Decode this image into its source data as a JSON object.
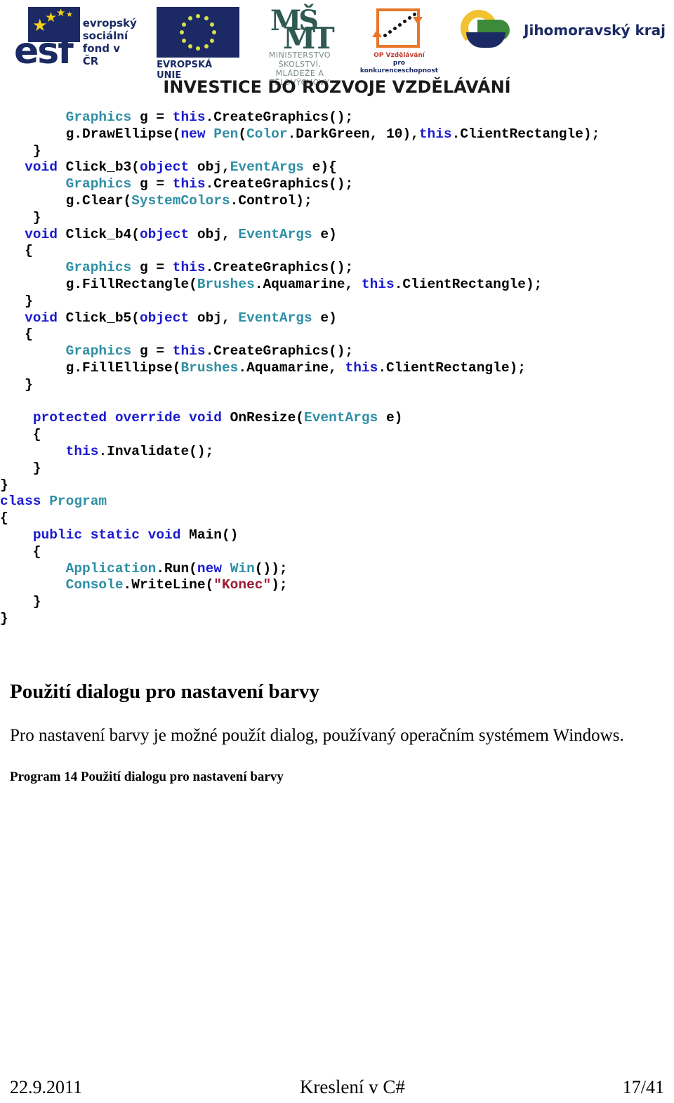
{
  "header": {
    "logos": [
      {
        "id": "esf-logo",
        "text_lines": [
          "evropský",
          "sociální",
          "fond v ČR"
        ],
        "wordmark": "esf"
      },
      {
        "id": "eu-flag-logo",
        "label": "EVROPSKÁ UNIE"
      },
      {
        "id": "msmt-logo",
        "mark_top": "MŠ",
        "mark_bottom": "MT",
        "label_line1": "MINISTERSTVO ŠKOLSTVÍ,",
        "label_line2": "MLÁDEŽE A TĚLOVÝCHOVY"
      },
      {
        "id": "op-vzdelavani-logo",
        "label_line1": "OP Vzdělávání",
        "label_line2": "pro konkurenceschopnost"
      },
      {
        "id": "jihomoravsky-kraj-logo",
        "label": "Jihomoravský kraj"
      }
    ],
    "banner_text": "INVESTICE DO ROZVOJE VZDĚLÁVÁNÍ"
  },
  "code": {
    "language": "csharp",
    "lines": [
      [
        {
          "t": "        ",
          "c": ""
        },
        {
          "t": "Graphics",
          "c": "typ"
        },
        {
          "t": " g = ",
          "c": ""
        },
        {
          "t": "this",
          "c": "kw"
        },
        {
          "t": ".CreateGraphics();",
          "c": ""
        }
      ],
      [
        {
          "t": "        g.DrawEllipse(",
          "c": ""
        },
        {
          "t": "new",
          "c": "kw"
        },
        {
          "t": " ",
          "c": ""
        },
        {
          "t": "Pen",
          "c": "typ"
        },
        {
          "t": "(",
          "c": ""
        },
        {
          "t": "Color",
          "c": "typ"
        },
        {
          "t": ".DarkGreen, 10),",
          "c": ""
        },
        {
          "t": "this",
          "c": "kw"
        },
        {
          "t": ".ClientRectangle);",
          "c": ""
        }
      ],
      [
        {
          "t": "    }",
          "c": ""
        }
      ],
      [
        {
          "t": "   ",
          "c": ""
        },
        {
          "t": "void",
          "c": "kw"
        },
        {
          "t": " Click_b3(",
          "c": ""
        },
        {
          "t": "object",
          "c": "kw"
        },
        {
          "t": " obj,",
          "c": ""
        },
        {
          "t": "EventArgs",
          "c": "typ"
        },
        {
          "t": " e){",
          "c": ""
        }
      ],
      [
        {
          "t": "        ",
          "c": ""
        },
        {
          "t": "Graphics",
          "c": "typ"
        },
        {
          "t": " g = ",
          "c": ""
        },
        {
          "t": "this",
          "c": "kw"
        },
        {
          "t": ".CreateGraphics();",
          "c": ""
        }
      ],
      [
        {
          "t": "        g.Clear(",
          "c": ""
        },
        {
          "t": "SystemColors",
          "c": "typ"
        },
        {
          "t": ".Control);",
          "c": ""
        }
      ],
      [
        {
          "t": "    }",
          "c": ""
        }
      ],
      [
        {
          "t": "   ",
          "c": ""
        },
        {
          "t": "void",
          "c": "kw"
        },
        {
          "t": " Click_b4(",
          "c": ""
        },
        {
          "t": "object",
          "c": "kw"
        },
        {
          "t": " obj, ",
          "c": ""
        },
        {
          "t": "EventArgs",
          "c": "typ"
        },
        {
          "t": " e)",
          "c": ""
        }
      ],
      [
        {
          "t": "   {",
          "c": ""
        }
      ],
      [
        {
          "t": "        ",
          "c": ""
        },
        {
          "t": "Graphics",
          "c": "typ"
        },
        {
          "t": " g = ",
          "c": ""
        },
        {
          "t": "this",
          "c": "kw"
        },
        {
          "t": ".CreateGraphics();",
          "c": ""
        }
      ],
      [
        {
          "t": "        g.FillRectangle(",
          "c": ""
        },
        {
          "t": "Brushes",
          "c": "typ"
        },
        {
          "t": ".Aquamarine, ",
          "c": ""
        },
        {
          "t": "this",
          "c": "kw"
        },
        {
          "t": ".ClientRectangle);",
          "c": ""
        }
      ],
      [
        {
          "t": "   }",
          "c": ""
        }
      ],
      [
        {
          "t": "   ",
          "c": ""
        },
        {
          "t": "void",
          "c": "kw"
        },
        {
          "t": " Click_b5(",
          "c": ""
        },
        {
          "t": "object",
          "c": "kw"
        },
        {
          "t": " obj, ",
          "c": ""
        },
        {
          "t": "EventArgs",
          "c": "typ"
        },
        {
          "t": " e)",
          "c": ""
        }
      ],
      [
        {
          "t": "   {",
          "c": ""
        }
      ],
      [
        {
          "t": "        ",
          "c": ""
        },
        {
          "t": "Graphics",
          "c": "typ"
        },
        {
          "t": " g = ",
          "c": ""
        },
        {
          "t": "this",
          "c": "kw"
        },
        {
          "t": ".CreateGraphics();",
          "c": ""
        }
      ],
      [
        {
          "t": "        g.FillEllipse(",
          "c": ""
        },
        {
          "t": "Brushes",
          "c": "typ"
        },
        {
          "t": ".Aquamarine, ",
          "c": ""
        },
        {
          "t": "this",
          "c": "kw"
        },
        {
          "t": ".ClientRectangle);",
          "c": ""
        }
      ],
      [
        {
          "t": "   }",
          "c": ""
        }
      ],
      [
        {
          "t": "",
          "c": ""
        }
      ],
      [
        {
          "t": "    ",
          "c": ""
        },
        {
          "t": "protected override void",
          "c": "kw"
        },
        {
          "t": " OnResize(",
          "c": ""
        },
        {
          "t": "EventArgs",
          "c": "typ"
        },
        {
          "t": " e)",
          "c": ""
        }
      ],
      [
        {
          "t": "    {",
          "c": ""
        }
      ],
      [
        {
          "t": "        ",
          "c": ""
        },
        {
          "t": "this",
          "c": "kw"
        },
        {
          "t": ".Invalidate();",
          "c": ""
        }
      ],
      [
        {
          "t": "    }",
          "c": ""
        }
      ],
      [
        {
          "t": "}",
          "c": ""
        }
      ],
      [
        {
          "t": "class",
          "c": "kw"
        },
        {
          "t": " ",
          "c": ""
        },
        {
          "t": "Program",
          "c": "typ"
        }
      ],
      [
        {
          "t": "{",
          "c": ""
        }
      ],
      [
        {
          "t": "    ",
          "c": ""
        },
        {
          "t": "public static void",
          "c": "kw"
        },
        {
          "t": " Main()",
          "c": ""
        }
      ],
      [
        {
          "t": "    {",
          "c": ""
        }
      ],
      [
        {
          "t": "        ",
          "c": ""
        },
        {
          "t": "Application",
          "c": "typ"
        },
        {
          "t": ".Run(",
          "c": ""
        },
        {
          "t": "new",
          "c": "kw"
        },
        {
          "t": " ",
          "c": ""
        },
        {
          "t": "Win",
          "c": "typ"
        },
        {
          "t": "());",
          "c": ""
        }
      ],
      [
        {
          "t": "        ",
          "c": ""
        },
        {
          "t": "Console",
          "c": "typ"
        },
        {
          "t": ".WriteLine(",
          "c": ""
        },
        {
          "t": "\"Konec\"",
          "c": "str"
        },
        {
          "t": ");",
          "c": ""
        }
      ],
      [
        {
          "t": "    }",
          "c": ""
        }
      ],
      [
        {
          "t": "}",
          "c": ""
        }
      ]
    ]
  },
  "content": {
    "heading": "Použití dialogu pro nastavení barvy",
    "paragraph": "Pro nastavení barvy je možné použít dialog, používaný operačním systémem Windows.",
    "caption": "Program  14 Použití dialogu pro nastavení barvy"
  },
  "footer": {
    "date": "22.9.2011",
    "title": "Kreslení v C#",
    "page": "17/41"
  },
  "colors": {
    "keyword": "#1a1ad0",
    "type": "#2f8fa5",
    "string": "#9c1b32",
    "text": "#000000",
    "logo_navy": "#1b2a64",
    "logo_orange": "#e8772a",
    "logo_yellow": "#f2c230",
    "logo_green": "#3d8a3a"
  }
}
